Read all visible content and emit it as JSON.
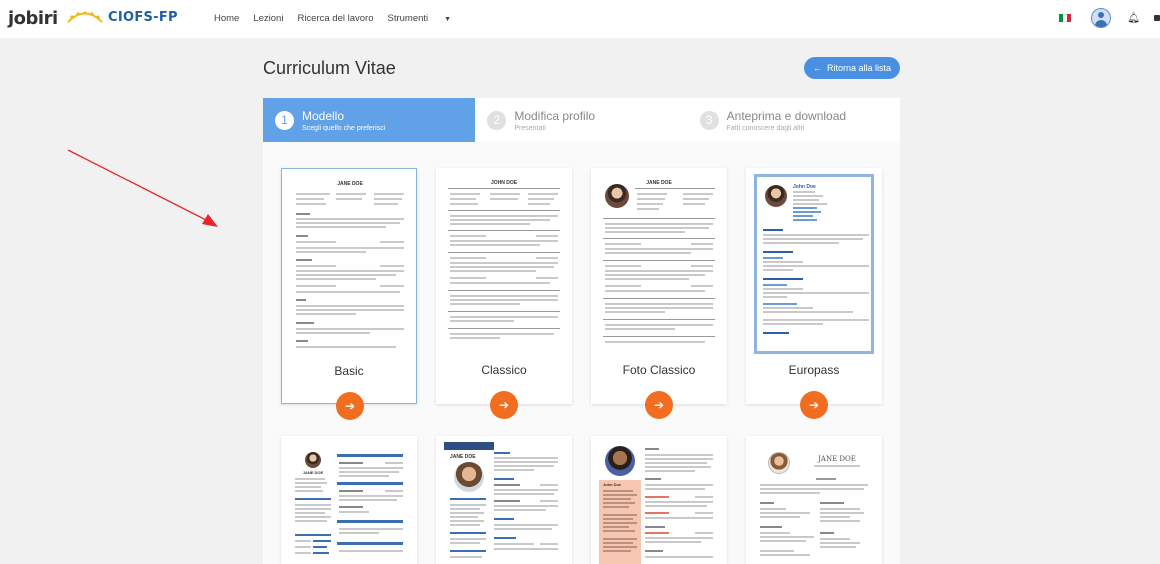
{
  "brand": {
    "logo_main": "jobiri",
    "logo_partner": "CIOFS-FP"
  },
  "nav": {
    "items": [
      "Home",
      "Lezioni",
      "Ricerca del lavoro",
      "Strumenti"
    ]
  },
  "header_right": {
    "flag_colors": [
      "#009246",
      "#ffffff",
      "#ce2b37"
    ]
  },
  "page": {
    "title": "Curriculum Vitae",
    "back_button": "Ritorna alla lista"
  },
  "steps": [
    {
      "number": "1",
      "title": "Modello",
      "subtitle": "Scegli quello che preferisci",
      "active": true
    },
    {
      "number": "2",
      "title": "Modifica profilo",
      "subtitle": "Presentati",
      "active": false
    },
    {
      "number": "3",
      "title": "Anteprima e download",
      "subtitle": "Fatti conoscere dagli altri",
      "active": false
    }
  ],
  "templates": [
    {
      "name": "Basic",
      "selected": true,
      "preview_name": "JANE DOE"
    },
    {
      "name": "Classico",
      "selected": false,
      "preview_name": "JOHN DOE"
    },
    {
      "name": "Foto Classico",
      "selected": false,
      "preview_name": "JANE DOE"
    },
    {
      "name": "Europass",
      "selected": false,
      "preview_name": "John Doe"
    }
  ],
  "templates_row2": [
    {
      "preview_name": "JANE DOE"
    },
    {
      "preview_name": "JANE DOE"
    },
    {
      "preview_name": "John Doe"
    },
    {
      "preview_name": "JANE DOE"
    }
  ],
  "colors": {
    "accent_blue": "#61a1e8",
    "button_blue": "#4a90e2",
    "action_orange": "#f26d1f",
    "annotation_red": "#e8262a"
  }
}
